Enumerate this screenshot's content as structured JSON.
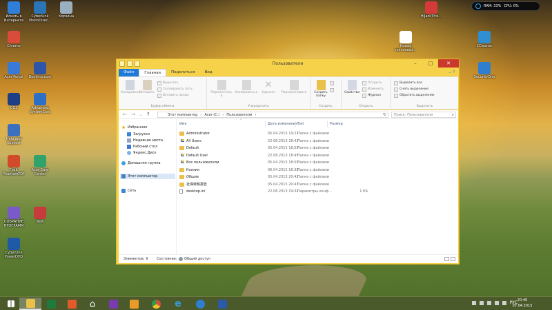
{
  "desktop": {
    "icons": [
      {
        "label": "Искать в Интернете",
        "color": "#2f7fd8",
        "icon": "search-internet-icon"
      },
      {
        "label": "CyberLink PhotoDirec...",
        "color": "#2a74b8",
        "icon": "photodirector-icon"
      },
      {
        "label": "Корзина",
        "color": "#9ab0c0",
        "icon": "recycle-bin-icon"
      },
      {
        "label": "Chrome",
        "color": "#d94b3b",
        "icon": "chrome-icon"
      },
      {
        "label": "Acer Portal",
        "color": "#3a7ad6",
        "icon": "acer-portal-icon"
      },
      {
        "label": "Booking.com",
        "color": "#2d56a8",
        "icon": "booking-icon"
      },
      {
        "label": "DOS",
        "color": "#1e3f86",
        "icon": "program-icon"
      },
      {
        "label": "Advanced SystemCare",
        "color": "#2e6fc6",
        "icon": "systemcare-icon"
      },
      {
        "label": "Help and Support",
        "color": "#3b6fbf",
        "icon": "help-icon"
      },
      {
        "label": "Foxit PhantomPDF",
        "color": "#d14a2a",
        "icon": "foxit-icon"
      },
      {
        "label": "Acer Care Center",
        "color": "#2fa36b",
        "icon": "care-center-icon"
      },
      {
        "label": "CyberLink PowerDVD",
        "color": "#1e5aa8",
        "icon": "powerdvd-icon"
      },
      {
        "label": "СОБРАНИЕ ПРОГРАММ",
        "color": "#7a5ac8",
        "icon": "program-icon"
      },
      {
        "label": "New",
        "color": "#c63c3c",
        "icon": "program-icon"
      },
      {
        "label": "Новый текстовый...",
        "color": "#ffffff",
        "icon": "text-file-icon"
      },
      {
        "label": "HiJackThis...",
        "color": "#d43a3a",
        "icon": "hijackthis-icon"
      },
      {
        "label": "CCleaner",
        "color": "#2f8fd0",
        "icon": "ccleaner-icon"
      },
      {
        "label": "SecurityOne",
        "color": "#2f7fd0",
        "icon": "security-icon"
      }
    ],
    "sysmon": {
      "ram": "RAM: 33%",
      "cpu": "CPU: 0%"
    }
  },
  "window": {
    "title": "Пользователи",
    "tabs": {
      "file": "Файл",
      "home": "Главная",
      "share": "Поделиться",
      "view": "Вид"
    },
    "ribbon": {
      "clipboard": {
        "label": "Буфер обмена",
        "copy": "Копировать",
        "paste": "Вставить",
        "cut": "Вырезать",
        "copy_path": "Скопировать путь",
        "paste_shortcut": "Вставить ярлык"
      },
      "organize": {
        "label": "Упорядочить",
        "move_to": "Переместить в",
        "copy_to": "Копировать в",
        "delete": "Удалить",
        "rename": "Переименовать"
      },
      "create": {
        "label": "Создать",
        "new_folder": "Создать папку"
      },
      "open": {
        "label": "Открыть",
        "properties": "Свойства",
        "open": "Открыть",
        "edit": "Изменить",
        "history": "Журнал"
      },
      "select": {
        "label": "Выделить",
        "select_all": "Выделить все",
        "select_none": "Снять выделение",
        "invert": "Обратить выделение"
      }
    },
    "address": {
      "crumbs": [
        "Этот компьютер",
        "Acer (C:)",
        "Пользователи"
      ],
      "search_placeholder": "Поиск: Пользователи"
    },
    "nav": {
      "favorites": "Избранное",
      "downloads": "Загрузки",
      "recent": "Недавние места",
      "desktop": "Рабочий стол",
      "yandex": "Яндекс.Диск",
      "homegroup": "Домашняя группа",
      "this_pc": "Этот компьютер",
      "network": "Сеть"
    },
    "columns": {
      "name": "Имя",
      "date": "Дата изменения",
      "type": "Тип",
      "size": "Размер"
    },
    "files": [
      {
        "name": "Administrator",
        "date": "05.04.2015 19:27",
        "type": "Папка с файлами",
        "size": "",
        "kind": "folder"
      },
      {
        "name": "All Users",
        "date": "22.08.2013 18:43",
        "type": "Папка с файлами",
        "size": "",
        "kind": "shortcut"
      },
      {
        "name": "Default",
        "date": "05.04.2015 18:59",
        "type": "Папка с файлами",
        "size": "",
        "kind": "folder"
      },
      {
        "name": "Default User",
        "date": "22.08.2013 18:45",
        "type": "Папка с файлами",
        "size": "",
        "kind": "shortcut"
      },
      {
        "name": "Все пользователи",
        "date": "05.04.2015 18:59",
        "type": "Папка с файлами",
        "size": "",
        "kind": "shortcut"
      },
      {
        "name": "Ксения",
        "date": "06.04.2015 16:38",
        "type": "Папка с файлами",
        "size": "",
        "kind": "folder"
      },
      {
        "name": "Общие",
        "date": "05.04.2015 20:42",
        "type": "Папка с файлами",
        "size": "",
        "kind": "folder"
      },
      {
        "name": "社保转移报告",
        "date": "05.04.2015 20:43",
        "type": "Папка с файлами",
        "size": "",
        "kind": "folder"
      },
      {
        "name": "desktop.ini",
        "date": "22.08.2013 19:34",
        "type": "Параметры конф...",
        "size": "1 КБ",
        "kind": "file"
      }
    ],
    "status": {
      "count": "Элементов: 9",
      "state_label": "Состояние:",
      "state_value": "Общий доступ"
    }
  },
  "taskbar": {
    "lang": "РУС",
    "time": "20:40",
    "date": "07.04.2015"
  }
}
